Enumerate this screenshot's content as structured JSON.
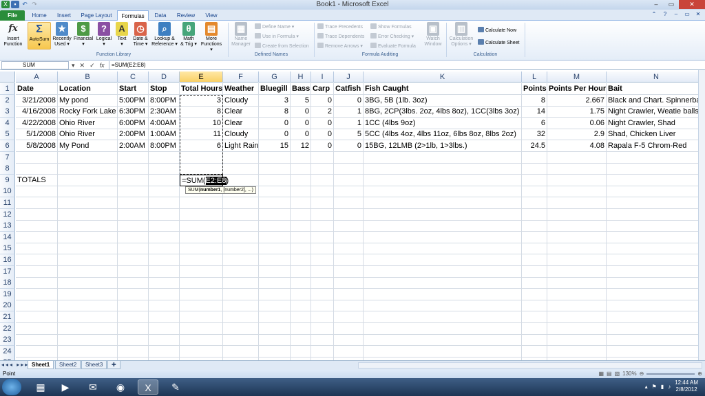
{
  "window": {
    "title": "Book1 - Microsoft Excel"
  },
  "ribbon": {
    "tabs": [
      "File",
      "Home",
      "Insert",
      "Page Layout",
      "Formulas",
      "Data",
      "Review",
      "View"
    ],
    "active_tab": "Formulas",
    "function_library": {
      "insert_function": [
        "Insert",
        "Function"
      ],
      "autosum": "AutoSum",
      "recently_used": [
        "Recently",
        "Used"
      ],
      "financial": "Financial",
      "logical": "Logical",
      "text": "Text",
      "date_time": [
        "Date &",
        "Time"
      ],
      "lookup_reference": [
        "Lookup &",
        "Reference"
      ],
      "math_trig": [
        "Math",
        "& Trig"
      ],
      "more_functions": [
        "More",
        "Functions"
      ],
      "group_label": "Function Library"
    },
    "defined_names": {
      "name_manager": [
        "Name",
        "Manager"
      ],
      "define_name": "Define Name",
      "use_in_formula": "Use in Formula",
      "create_from_selection": "Create from Selection",
      "group_label": "Defined Names"
    },
    "formula_auditing": {
      "trace_precedents": "Trace Precedents",
      "trace_dependents": "Trace Dependents",
      "remove_arrows": "Remove Arrows",
      "show_formulas": "Show Formulas",
      "error_checking": "Error Checking",
      "evaluate_formula": "Evaluate Formula",
      "watch_window": [
        "Watch",
        "Window"
      ],
      "group_label": "Formula Auditing"
    },
    "calculation": {
      "calculation_options": [
        "Calculation",
        "Options"
      ],
      "calculate_now": "Calculate Now",
      "calculate_sheet": "Calculate Sheet",
      "group_label": "Calculation"
    }
  },
  "formula_bar": {
    "name_box": "SUM",
    "formula": "=SUM(E2:E8)"
  },
  "grid": {
    "columns": [
      "A",
      "B",
      "C",
      "D",
      "E",
      "F",
      "G",
      "H",
      "I",
      "J",
      "K",
      "L",
      "M",
      "N"
    ],
    "row_numbers": [
      "1",
      "2",
      "3",
      "4",
      "5",
      "6",
      "7",
      "8",
      "9",
      "10",
      "11",
      "12",
      "13",
      "14",
      "15",
      "16",
      "17",
      "18",
      "19",
      "20",
      "21",
      "22",
      "23",
      "24",
      "25"
    ],
    "headers": [
      "Date",
      "Location",
      "Start",
      "Stop",
      "Total Hours",
      "Weather",
      "Bluegill",
      "Bass",
      "Carp",
      "Catfish",
      "Fish Caught",
      "Points",
      "Points Per Hour",
      "Bait"
    ],
    "rows": [
      [
        "3/21/2008",
        "My pond",
        "5:00PM",
        "8:00PM",
        "3",
        "Cloudy",
        "3",
        "5",
        "0",
        "0",
        "3BG, 5B (1lb. 3oz)",
        "8",
        "2.667",
        "Black and Chart. Spinnerba"
      ],
      [
        "4/16/2008",
        "Rocky Fork Lake",
        "6:30PM",
        "2:30AM",
        "8",
        "Clear",
        "8",
        "0",
        "2",
        "1",
        "8BG, 2CP(3lbs. 2oz, 4lbs 8oz), 1CC(3lbs 3oz)",
        "14",
        "1.75",
        "Night Crawler, Weatie balls"
      ],
      [
        "4/22/2008",
        "Ohio River",
        "6:00PM",
        "4:00AM",
        "10",
        "Clear",
        "0",
        "0",
        "0",
        "1",
        "1CC (4lbs 9oz)",
        "6",
        "0.06",
        "Night Crawler, Shad"
      ],
      [
        "5/1/2008",
        "Ohio River",
        "2:00PM",
        "1:00AM",
        "11",
        "Cloudy",
        "0",
        "0",
        "0",
        "5",
        "5CC (4lbs 4oz, 4lbs 11oz, 6lbs 8oz, 8lbs 2oz)",
        "32",
        "2.9",
        "Shad, Chicken Liver"
      ],
      [
        "5/8/2008",
        "My Pond",
        "2:00AM",
        "8:00PM",
        "6",
        "Light Rain",
        "15",
        "12",
        "0",
        "0",
        "15BG, 12LMB (2>1lb, 1>3lbs.)",
        "24.5",
        "4.08",
        "Rapala F-5 Chrom-Red"
      ]
    ],
    "totals_label": "TOTALS",
    "editing_cell": {
      "prefix": "=SUM(",
      "range": "E2:E8",
      "suffix": ")"
    },
    "tooltip": {
      "fn": "SUM(",
      "arg1": "number1",
      "rest": ", [number2], ...)"
    }
  },
  "sheets": [
    "Sheet1",
    "Sheet2",
    "Sheet3"
  ],
  "active_sheet": "Sheet1",
  "status": {
    "mode": "Point",
    "zoom": "130%"
  },
  "taskbar": {
    "time": "12:44 AM",
    "date": "2/8/2012"
  },
  "colors": {
    "excel_green": "#2a8d3a",
    "selection_header": "#f9d066",
    "ribbon_blue": "#dfe9f5"
  }
}
